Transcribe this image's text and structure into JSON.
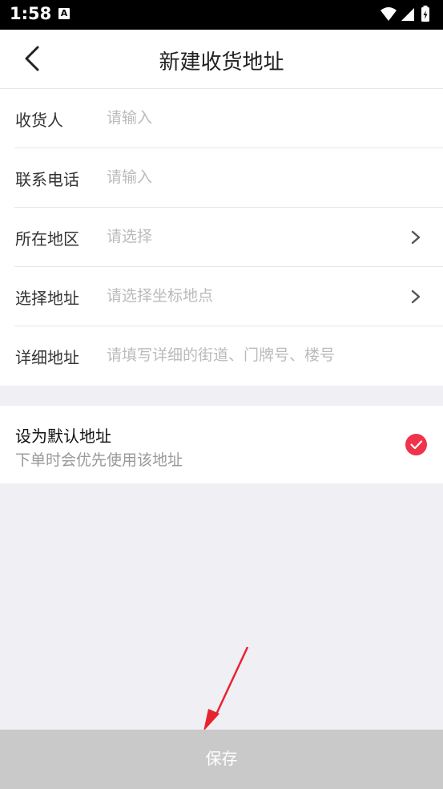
{
  "status_bar": {
    "time": "1:58",
    "notification_icon_letter": "A"
  },
  "header": {
    "title": "新建收货地址",
    "back_icon": "chevron-left-icon"
  },
  "form": {
    "fields": [
      {
        "label": "收货人",
        "placeholder": "请输入",
        "has_arrow": false
      },
      {
        "label": "联系电话",
        "placeholder": "请输入",
        "has_arrow": false
      },
      {
        "label": "所在地区",
        "placeholder": "请选择",
        "has_arrow": true
      },
      {
        "label": "选择地址",
        "placeholder": "请选择坐标地点",
        "has_arrow": true
      },
      {
        "label": "详细地址",
        "placeholder": "请填写详细的街道、门牌号、楼号",
        "has_arrow": false
      }
    ]
  },
  "default_address": {
    "title": "设为默认地址",
    "subtitle": "下单时会优先使用该地址",
    "checked": true
  },
  "save_button": {
    "label": "保存"
  },
  "colors": {
    "accent": "#f0334b",
    "save_disabled": "#c9c9c9",
    "background": "#efeff4"
  }
}
